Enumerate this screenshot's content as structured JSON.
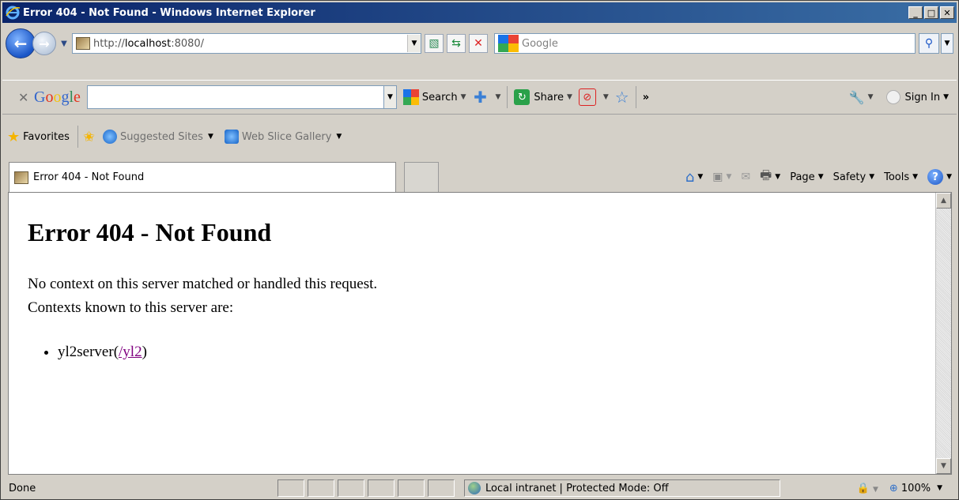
{
  "window": {
    "title": "Error 404 - Not Found - Windows Internet Explorer",
    "controls": {
      "minimize": "_",
      "maximize": "□",
      "close": "✕"
    }
  },
  "address_bar": {
    "url_prefix": "http://",
    "url_host": "localhost",
    "url_suffix": ":8080/",
    "search_placeholder": "Google"
  },
  "google_toolbar": {
    "logo": "Google",
    "search_label": "Search",
    "share_label": "Share",
    "more_glyph": "»",
    "sign_in_label": "Sign In"
  },
  "favorites_bar": {
    "favorites_label": "Favorites",
    "suggested_sites_label": "Suggested Sites",
    "web_slice_label": "Web Slice Gallery"
  },
  "tab": {
    "title": "Error 404 - Not Found"
  },
  "command_bar": {
    "page_label": "Page",
    "safety_label": "Safety",
    "tools_label": "Tools"
  },
  "content": {
    "heading": "Error 404 - Not Found",
    "line1": "No context on this server matched or handled this request.",
    "line2": "Contexts known to this server are:",
    "contexts": [
      {
        "name": "yl2server",
        "path": "/yl2"
      }
    ]
  },
  "status_bar": {
    "status_text": "Done",
    "zone_text": "Local intranet | Protected Mode: Off",
    "zoom_text": "100%"
  },
  "colors": {
    "titlebar": "#0a246a",
    "visited_link": "#800080"
  },
  "icons": [
    "ie-logo",
    "back-icon",
    "forward-icon",
    "page-icon",
    "compatibility-icon",
    "refresh-icon",
    "stop-icon",
    "search-icon",
    "google-icon",
    "add-icon",
    "share-icon",
    "popup-blocker-icon",
    "bookmark-star-icon",
    "wrench-icon",
    "favorites-star-icon",
    "add-favorite-icon",
    "ie-icon",
    "home-icon",
    "feeds-icon",
    "mail-icon",
    "print-icon",
    "help-icon",
    "globe-icon",
    "lock-icon",
    "zoom-icon"
  ]
}
